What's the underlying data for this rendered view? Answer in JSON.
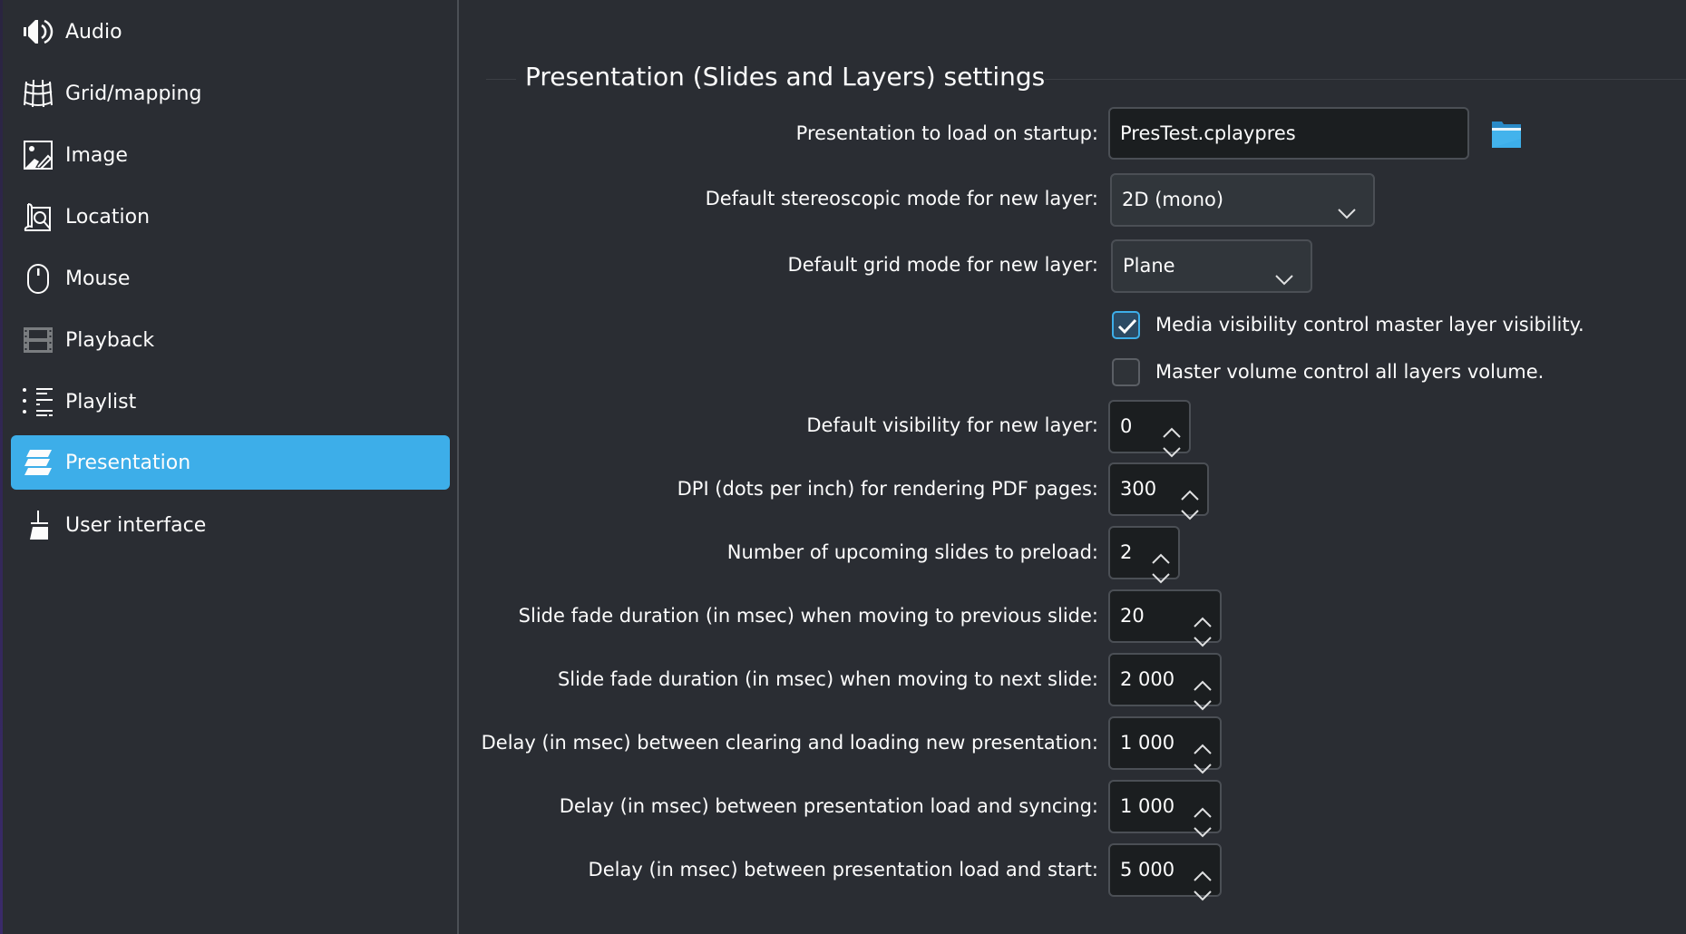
{
  "sidebar": {
    "items": [
      {
        "label": "Audio",
        "icon": "speaker-icon",
        "selected": false
      },
      {
        "label": "Grid/mapping",
        "icon": "grid-mapping-icon",
        "selected": false
      },
      {
        "label": "Image",
        "icon": "image-icon",
        "selected": false
      },
      {
        "label": "Location",
        "icon": "location-map-search-icon",
        "selected": false
      },
      {
        "label": "Mouse",
        "icon": "mouse-icon",
        "selected": false
      },
      {
        "label": "Playback",
        "icon": "film-strip-icon",
        "selected": false
      },
      {
        "label": "Playlist",
        "icon": "playlist-icon",
        "selected": false
      },
      {
        "label": "Presentation",
        "icon": "layers-icon",
        "selected": true
      },
      {
        "label": "User interface",
        "icon": "brush-icon",
        "selected": false
      }
    ],
    "selected_color": "#3daee9"
  },
  "main": {
    "group_title": "Presentation (Slides and Layers) settings",
    "startup": {
      "label": "Presentation to load on startup:",
      "value": "PresTest.cplaypres",
      "browse_icon": "folder-icon"
    },
    "stereo_mode": {
      "label": "Default stereoscopic mode for new layer:",
      "selected": "2D (mono)"
    },
    "grid_mode": {
      "label": "Default grid mode for new layer:",
      "selected": "Plane"
    },
    "checkboxes": [
      {
        "label": "Media visibility control master layer visibility.",
        "checked": true
      },
      {
        "label": "Master volume control all layers volume.",
        "checked": false
      }
    ],
    "spinboxes": [
      {
        "label": "Default visibility for new layer:",
        "value": "0"
      },
      {
        "label": "DPI (dots per inch) for rendering PDF pages:",
        "value": "300"
      },
      {
        "label": "Number of upcoming slides to preload:",
        "value": "2"
      },
      {
        "label": "Slide fade duration (in msec) when moving to previous slide:",
        "value": "20"
      },
      {
        "label": "Slide fade duration (in msec) when moving to next slide:",
        "value": "2 000"
      },
      {
        "label": "Delay (in msec) between clearing and loading new presentation:",
        "value": "1 000"
      },
      {
        "label": "Delay (in msec) between presentation load and syncing:",
        "value": "1 000"
      },
      {
        "label": "Delay (in msec) between presentation load and start:",
        "value": "5 000"
      }
    ],
    "accent_color": "#3daee9"
  }
}
